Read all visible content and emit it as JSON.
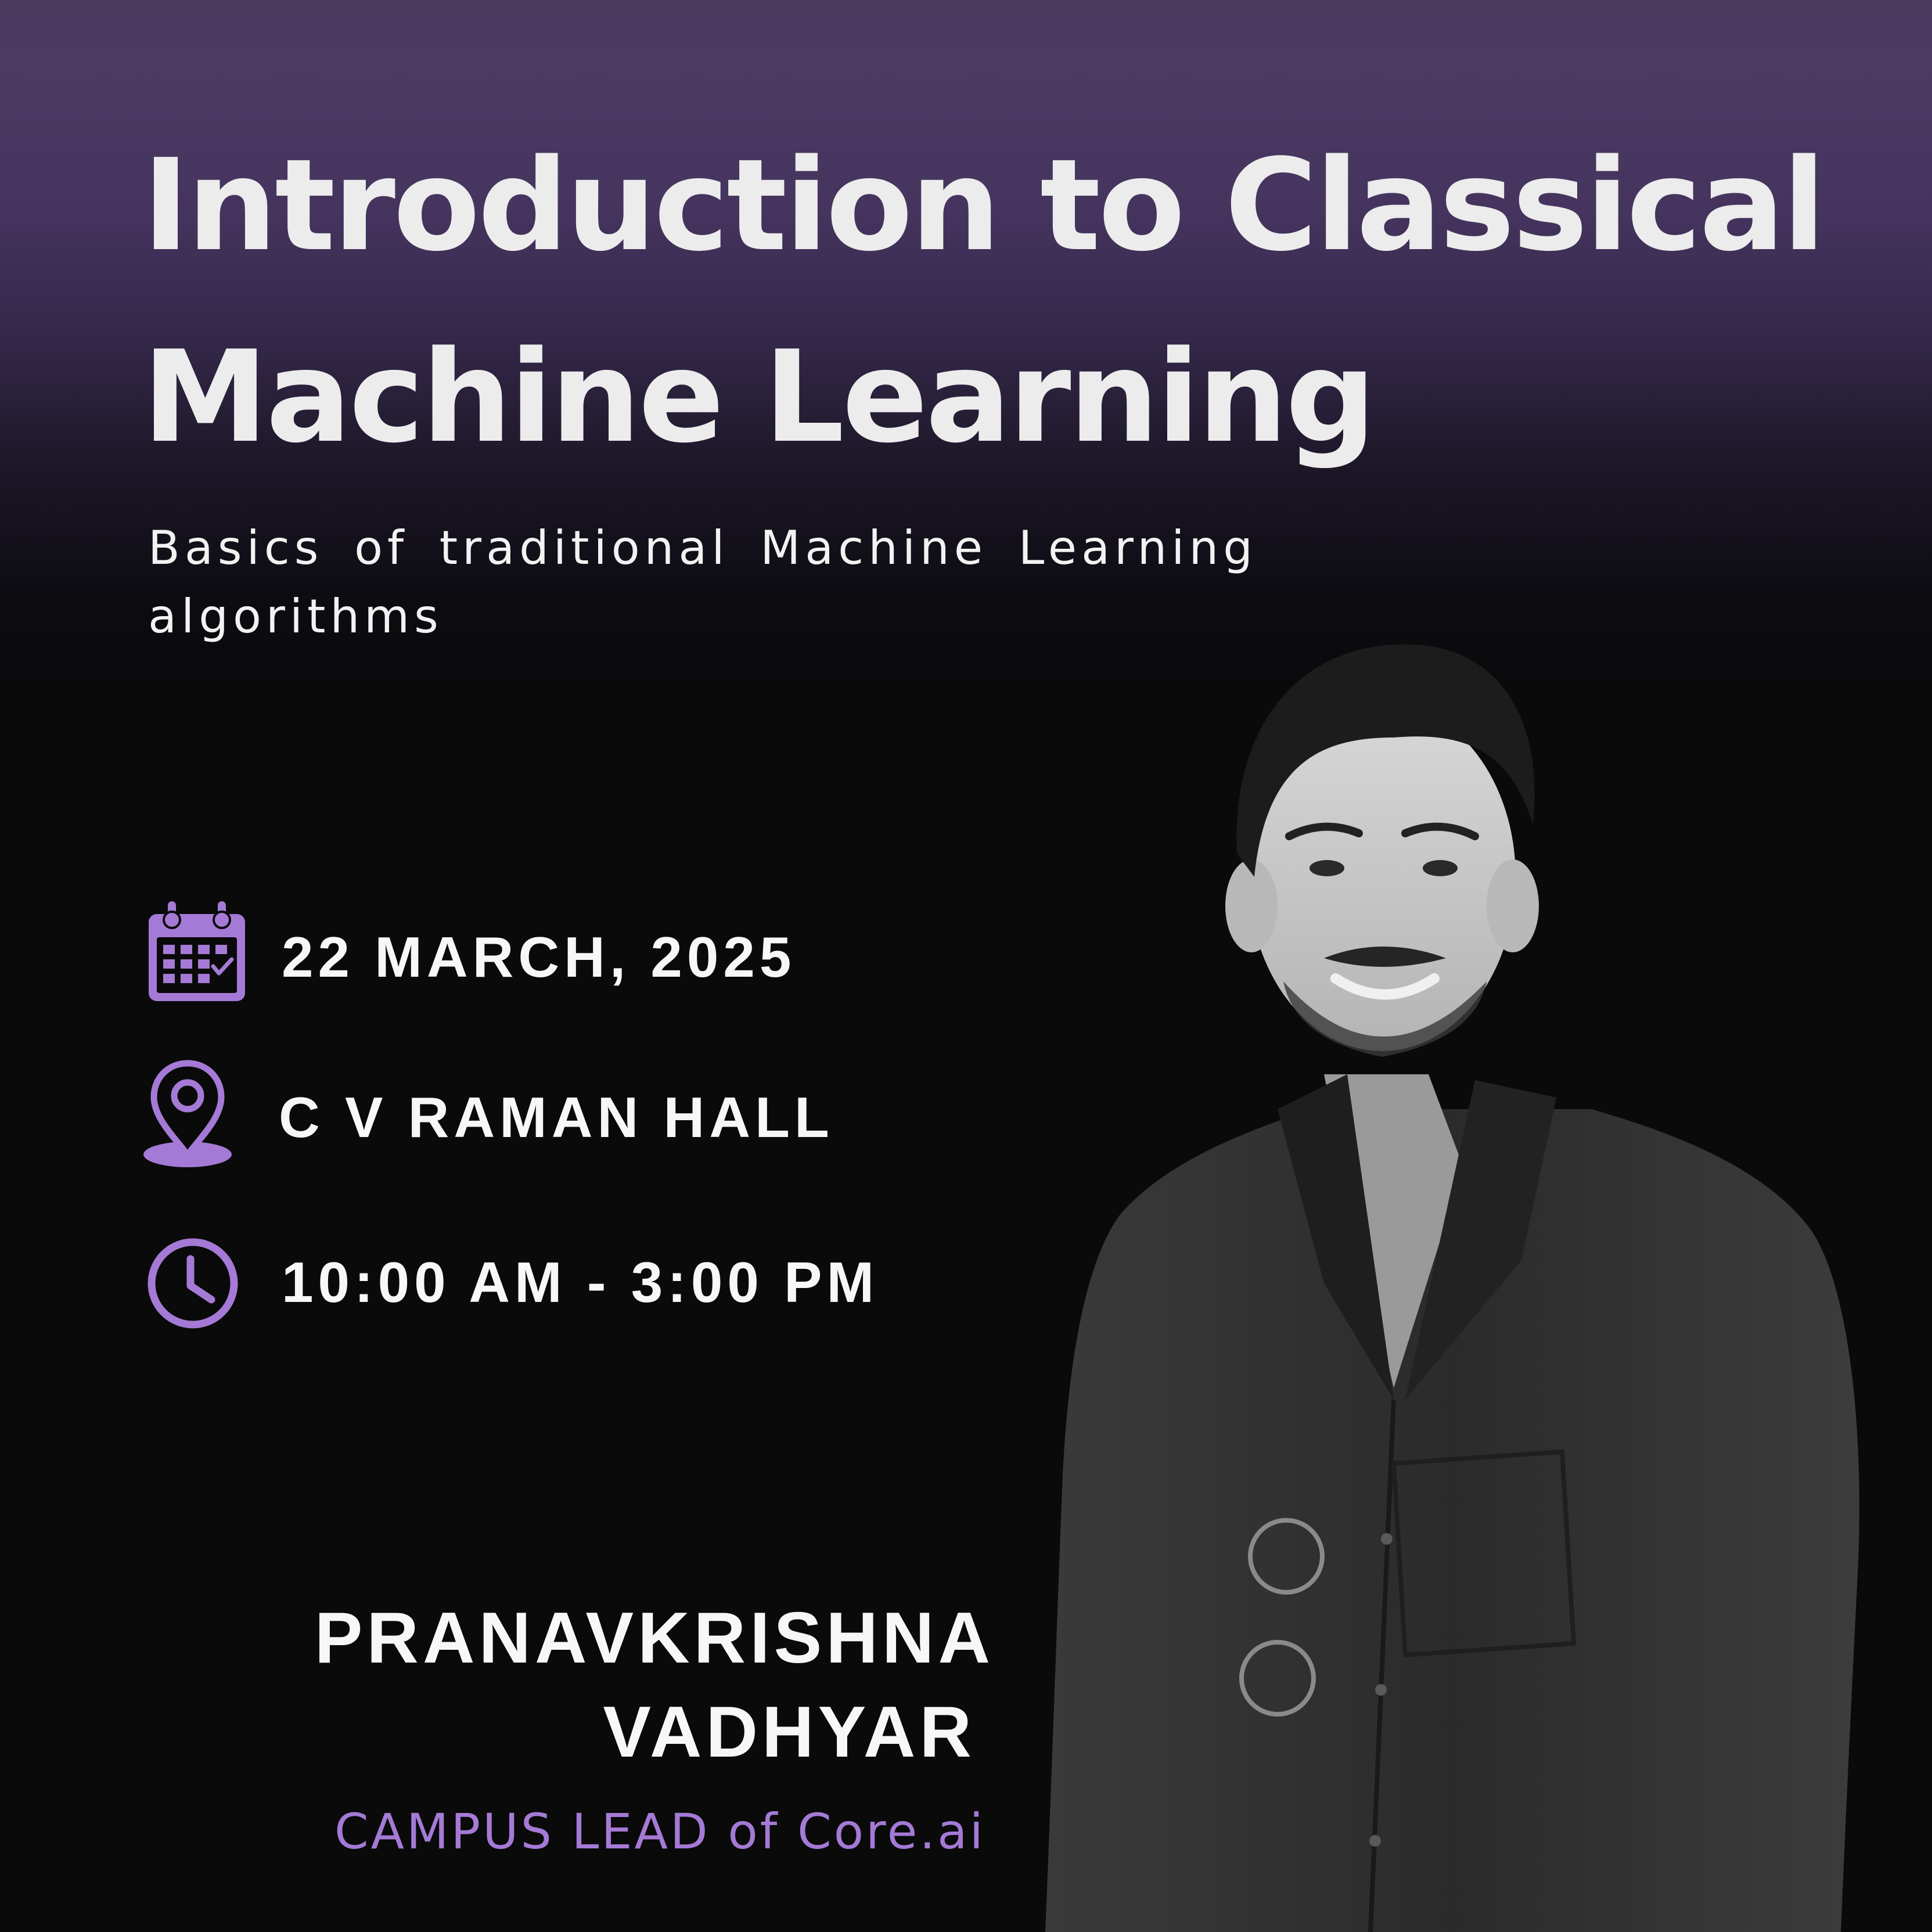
{
  "title": {
    "line1": "Introduction to Classical",
    "line2": "Machine Learning"
  },
  "subtitle": "Basics of traditional Machine Learning algorithms",
  "event": {
    "date": "22 MARCH, 2025",
    "venue": "C V RAMAN HALL",
    "time": "10:00 AM - 3:00 PM"
  },
  "speaker": {
    "name_line1": "PRANAVKRISHNA",
    "name_line2": "VADHYAR",
    "role": "CAMPUS LEAD of Core.ai"
  },
  "icons": {
    "date": "calendar-icon",
    "venue": "location-pin-icon",
    "time": "clock-icon"
  },
  "colors": {
    "header_purple": "#4b3a62",
    "accent_purple": "#a57ad6",
    "background": "#0a0a0a",
    "text": "#f2f2f2"
  }
}
